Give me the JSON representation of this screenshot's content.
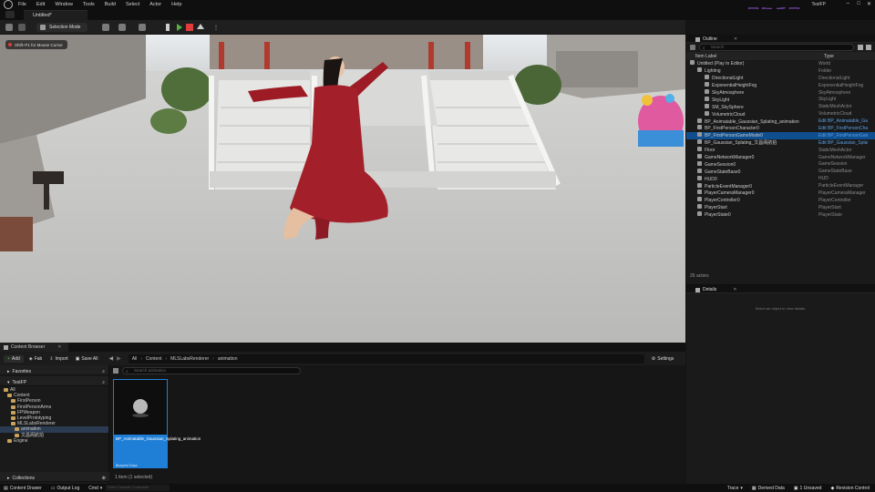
{
  "menubar": {
    "items": [
      "File",
      "Edit",
      "Window",
      "Tools",
      "Build",
      "Select",
      "Actor",
      "Help"
    ],
    "project": "TestFP",
    "watermark": "国际乐园"
  },
  "tabbar": {
    "tab_label": "Untitled*"
  },
  "toolbar": {
    "selection_mode": "Selection Mode"
  },
  "viewport": {
    "hint": "Shift+F1 for Mouse Cursor"
  },
  "outliner": {
    "tab": "Outline",
    "search_placeholder": "Search",
    "col_label": "Item Label",
    "col_type": "Type",
    "rows": [
      {
        "label": "Untitled (Play In Editor)",
        "type": "World",
        "indent": 0
      },
      {
        "label": "Lighting",
        "type": "Folder",
        "indent": 1
      },
      {
        "label": "DirectionalLight",
        "type": "DirectionalLight",
        "indent": 2
      },
      {
        "label": "ExponentialHeightFog",
        "type": "ExponentialHeightFog",
        "indent": 2
      },
      {
        "label": "SkyAtmosphere",
        "type": "SkyAtmosphere",
        "indent": 2
      },
      {
        "label": "SkyLight",
        "type": "SkyLight",
        "indent": 2
      },
      {
        "label": "SM_SkySphere",
        "type": "StaticMeshActor",
        "indent": 2
      },
      {
        "label": "VolumetricCloud",
        "type": "VolumetricCloud",
        "indent": 2
      },
      {
        "label": "BP_Animatable_Gaussian_Splating_animation",
        "type": "Edit BP_Animatable_Ga",
        "indent": 1,
        "link": true
      },
      {
        "label": "BP_FirstPersonCharacter0",
        "type": "Edit BP_FirstPersonCha",
        "indent": 1,
        "link": true
      },
      {
        "label": "BP_FirstPersonGameMode0",
        "type": "Edit BP_FirstPersonGam",
        "indent": 1,
        "link": true,
        "selected": true
      },
      {
        "label": "BP_Gaussian_Splating_文昌阁航拍",
        "type": "Edit BP_Gaussian_Splat",
        "indent": 1,
        "link": true
      },
      {
        "label": "Floor",
        "type": "StaticMeshActor",
        "indent": 1
      },
      {
        "label": "GameNetworkManager0",
        "type": "GameNetworkManager",
        "indent": 1
      },
      {
        "label": "GameSession0",
        "type": "GameSession",
        "indent": 1
      },
      {
        "label": "GameStateBase0",
        "type": "GameStateBase",
        "indent": 1
      },
      {
        "label": "HUD0",
        "type": "HUD",
        "indent": 1
      },
      {
        "label": "ParticleEventManager0",
        "type": "ParticleEventManager",
        "indent": 1
      },
      {
        "label": "PlayerCameraManager0",
        "type": "PlayerCameraManager",
        "indent": 1
      },
      {
        "label": "PlayerController0",
        "type": "PlayerController",
        "indent": 1
      },
      {
        "label": "PlayerStart",
        "type": "PlayerStart",
        "indent": 1
      },
      {
        "label": "PlayerState0",
        "type": "PlayerState",
        "indent": 1
      }
    ],
    "actor_count": "26 actors"
  },
  "details": {
    "tab": "Details",
    "empty_msg": "Select an object to view details."
  },
  "content_browser": {
    "tab": "Content Browser",
    "add": "Add",
    "fab": "Fab",
    "import": "Import",
    "save_all": "Save All",
    "breadcrumb": [
      "All",
      "Content",
      "MLSLabsRenderer",
      "animation"
    ],
    "settings": "Settings",
    "favorites": "Favorites",
    "project": "TestFP",
    "search_placeholder": "Search animation",
    "tree": [
      {
        "label": "All",
        "indent": 0
      },
      {
        "label": "Content",
        "indent": 1
      },
      {
        "label": "FirstPerson",
        "indent": 2
      },
      {
        "label": "FirstPersonArms",
        "indent": 2
      },
      {
        "label": "FPWeapon",
        "indent": 2
      },
      {
        "label": "LevelPrototyping",
        "indent": 2
      },
      {
        "label": "MLSLabsRenderer",
        "indent": 2
      },
      {
        "label": "animation",
        "indent": 3,
        "selected": true
      },
      {
        "label": "文昌阁航拍",
        "indent": 3
      },
      {
        "label": "Engine",
        "indent": 1
      }
    ],
    "collections": "Collections",
    "asset_name": "BP_Animatable_Gaussian_Splating_animation",
    "asset_type": "Blueprint Class",
    "item_count": "1 item (1 selected)"
  },
  "statusbar": {
    "content_drawer": "Content Drawer",
    "output_log": "Output Log",
    "cmd": "Cmd",
    "cmd_placeholder": "Enter Console Command",
    "trace": "Trace",
    "derived_data": "Derived Data",
    "unsaved": "1 Unsaved",
    "revision": "Revision Control"
  }
}
